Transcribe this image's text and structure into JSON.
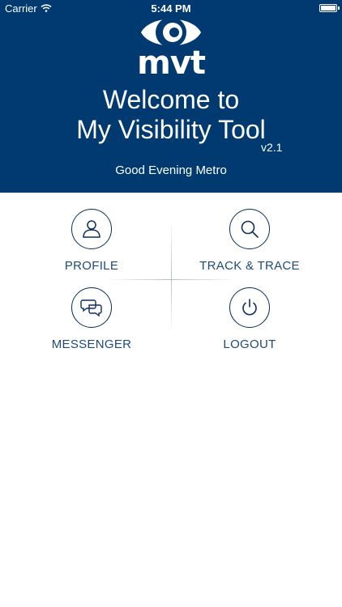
{
  "status_bar": {
    "carrier": "Carrier",
    "time": "5:44 PM"
  },
  "header": {
    "logo_text": "mvt",
    "welcome_line1": "Welcome to",
    "welcome_line2": "My Visibility Tool",
    "version": "v2.1",
    "greeting": "Good Evening Metro"
  },
  "menu": {
    "items": [
      {
        "label": "PROFILE",
        "icon": "user-icon"
      },
      {
        "label": "TRACK & TRACE",
        "icon": "search-icon"
      },
      {
        "label": "MESSENGER",
        "icon": "chat-bubbles-icon"
      },
      {
        "label": "LOGOUT",
        "icon": "power-icon"
      }
    ]
  },
  "colors": {
    "header_bg": "#003a70",
    "icon_stroke": "#0b2f5b",
    "label_text": "#1d4a7a"
  }
}
